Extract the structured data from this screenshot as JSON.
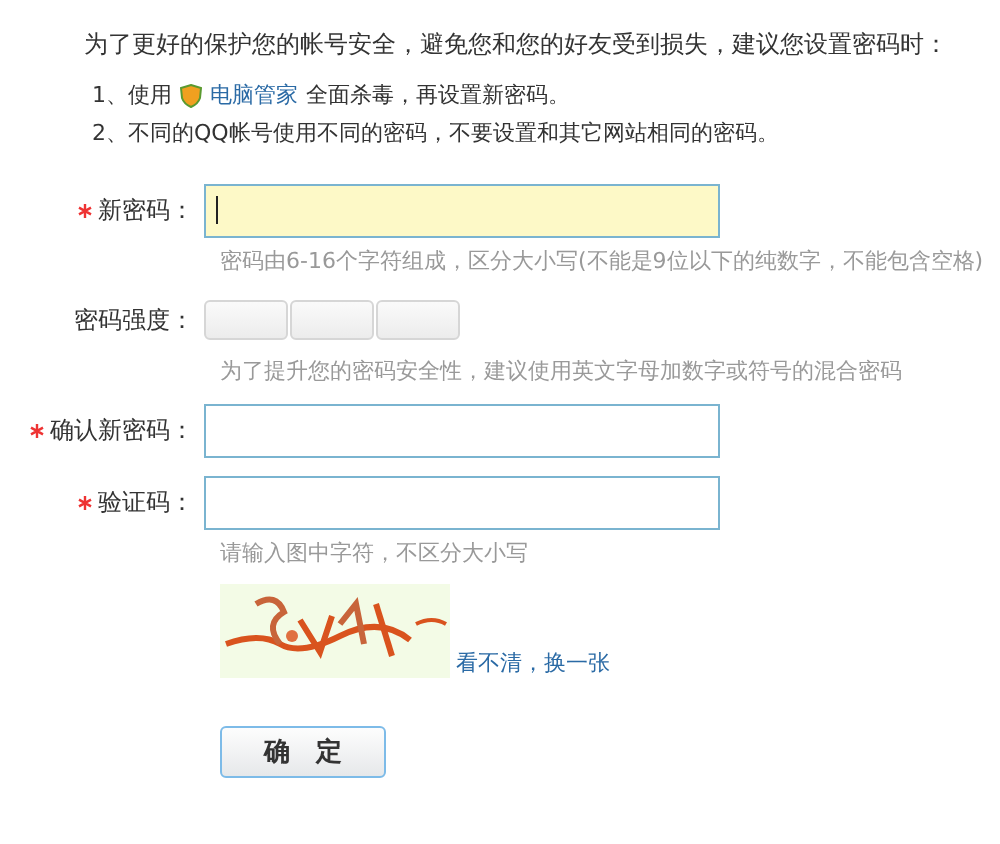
{
  "intro": "为了更好的保护您的帐号安全，避免您和您的好友受到损失，建议您设置密码时：",
  "tips": [
    {
      "before": "1、使用",
      "link": "电脑管家",
      "after": "全面杀毒，再设置新密码。"
    },
    {
      "before": "2、不同的QQ帐号使用不同的密码，不要设置和其它网站相同的密码。"
    }
  ],
  "fields": [
    {
      "kind": "input",
      "label": "新密码：",
      "required": true,
      "focused": true,
      "hint": "密码由6-16个字符组成，区分大小写(不能是9位以下的纯数字，不能包含空格)"
    },
    {
      "kind": "strength",
      "label": "密码强度：",
      "hint": "为了提升您的密码安全性，建议使用英文字母加数字或符号的混合密码"
    },
    {
      "kind": "input",
      "label": "确认新密码：",
      "required": true,
      "focused": false
    },
    {
      "kind": "input",
      "label": "验证码：",
      "required": true,
      "focused": false,
      "hint": "请输入图中字符，不区分大小写"
    }
  ],
  "captcha": {
    "kind": "picture",
    "refresh_link": "看不清，换一张"
  },
  "submit": "确　定"
}
